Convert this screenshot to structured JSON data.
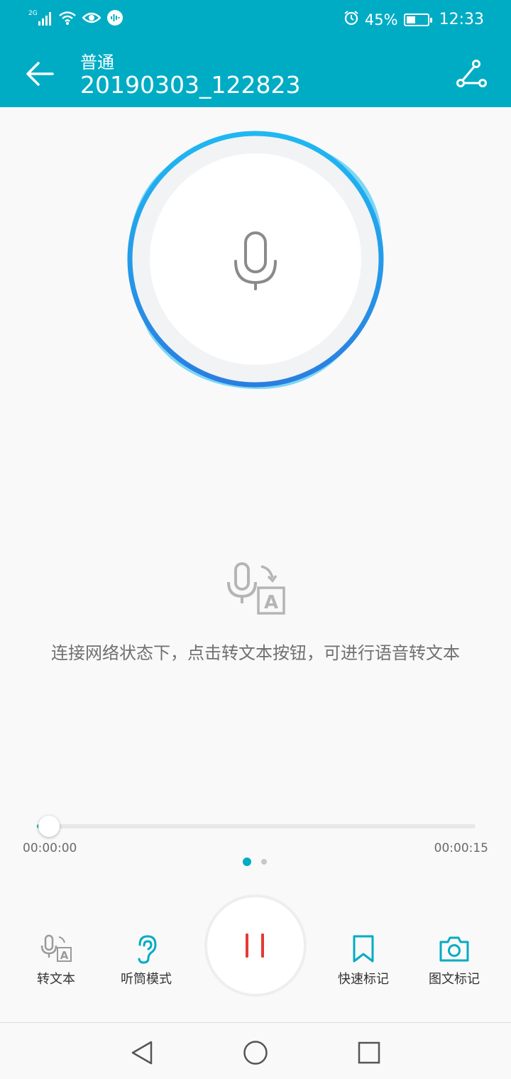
{
  "status_bar": {
    "network": "2G",
    "battery_pct": "45%",
    "battery_level": 0.45,
    "time": "12:33",
    "icons": [
      "signal-icon",
      "wifi-icon",
      "eye-icon",
      "audio-icon",
      "alarm-icon",
      "battery-icon"
    ]
  },
  "header": {
    "subtitle": "普通",
    "title": "20190303_122823",
    "background": "#00acc4"
  },
  "main": {
    "hint": "连接网络状态下，点击转文本按钮，可进行语音转文本"
  },
  "player": {
    "current_time": "00:00:00",
    "total_time": "00:00:15",
    "progress": 0.01,
    "page_count": 2,
    "active_page": 1
  },
  "actions": {
    "to_text": "转文本",
    "earpiece_mode": "听筒模式",
    "quick_mark": "快速标记",
    "photo_mark": "图文标记"
  },
  "colors": {
    "accent": "#00acc4",
    "pause": "#e53935"
  }
}
